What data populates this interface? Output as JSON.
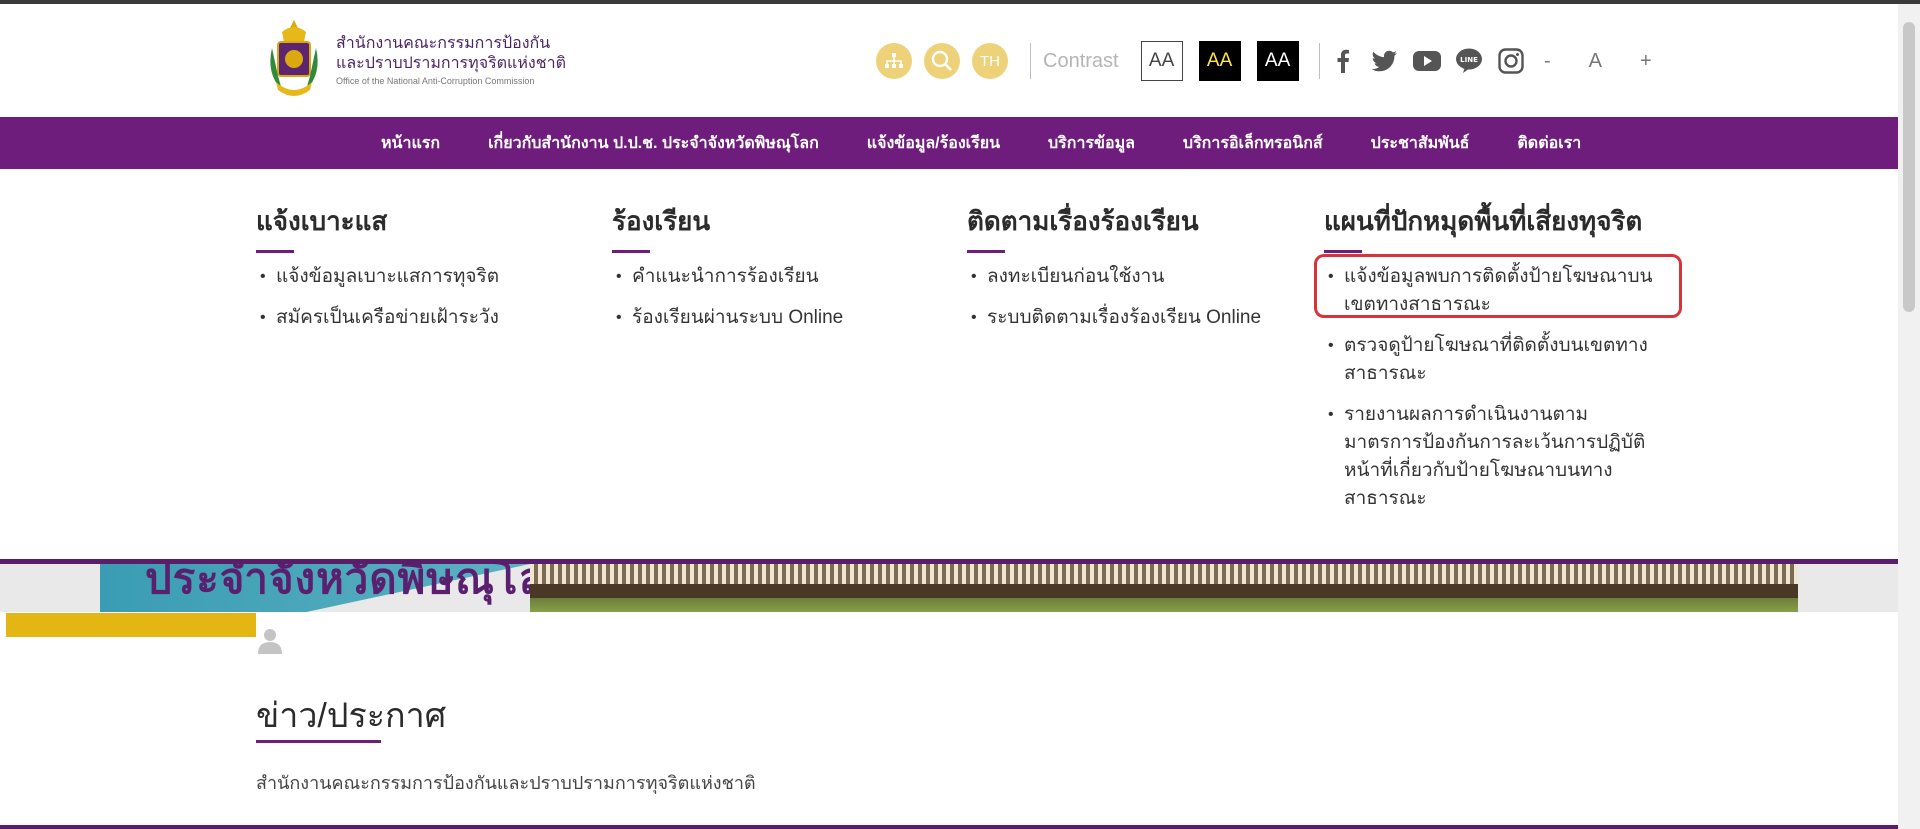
{
  "header": {
    "org_name_th_line1": "สำนักงานคณะกรรมการป้องกัน",
    "org_name_th_line2": "และปราบปรามการทุจริตแห่งชาติ",
    "org_name_en": "Office of the National Anti-Corruption Commission",
    "icons": [
      "sitemap-icon",
      "search-icon",
      "language-icon"
    ],
    "language_label": "TH",
    "contrast_label": "Contrast",
    "contrast_options": [
      "AA",
      "AA",
      "AA"
    ],
    "social_icons": [
      "facebook-icon",
      "twitter-icon",
      "youtube-icon",
      "line-icon",
      "instagram-icon"
    ],
    "font_decrease": "-",
    "font_normal": "A",
    "font_increase": "+"
  },
  "nav": {
    "items": [
      "หน้าแรก",
      "เกี่ยวกับสำนักงาน ป.ป.ช. ประจำจังหวัดพิษณุโลก",
      "แจ้งข้อมูล/ร้องเรียน",
      "บริการข้อมูล",
      "บริการอิเล็กทรอนิกส์",
      "ประชาสัมพันธ์",
      "ติดต่อเรา"
    ]
  },
  "mega_menu": {
    "columns": [
      {
        "title": "แจ้งเบาะแส",
        "items": [
          "แจ้งข้อมูลเบาะแสการทุจริต",
          "สมัครเป็นเครือข่ายเฝ้าระวัง"
        ]
      },
      {
        "title": "ร้องเรียน",
        "items": [
          "คำแนะนำการร้องเรียน",
          "ร้องเรียนผ่านระบบ Online"
        ]
      },
      {
        "title": "ติดตามเรื่องร้องเรียน",
        "items": [
          "ลงทะเบียนก่อนใช้งาน",
          "ระบบติดตามเรื่องร้องเรียน Online"
        ]
      },
      {
        "title": "แผนที่ปักหมุดพื้นที่เสี่ยงทุจริต",
        "items": [
          "แจ้งข้อมูลพบการติดตั้งป้ายโฆษณาบนเขตทางสาธารณะ",
          "ตรวจดูป้ายโฆษณาที่ติดตั้งบนเขตทางสาธารณะ",
          "รายงานผลการดำเนินงานตามมาตรการป้องกันการละเว้นการปฏิบัติหน้าที่เกี่ยวกับป้ายโฆษณาบนทางสาธารณะ"
        ]
      }
    ]
  },
  "banner": {
    "partial_text": "ประจำจังหวัดพิษณุโลก"
  },
  "news": {
    "title": "ข่าว/ประกาศ",
    "subtitle": "สำนักงานคณะกรรมการป้องกันและปราบปรามการทุจริตแห่งชาติ"
  },
  "colors": {
    "brand_purple": "#6f1d7d",
    "accent_gold": "#eed27a",
    "highlight_red": "#d8333a",
    "yellow_bar": "#e4b614"
  }
}
